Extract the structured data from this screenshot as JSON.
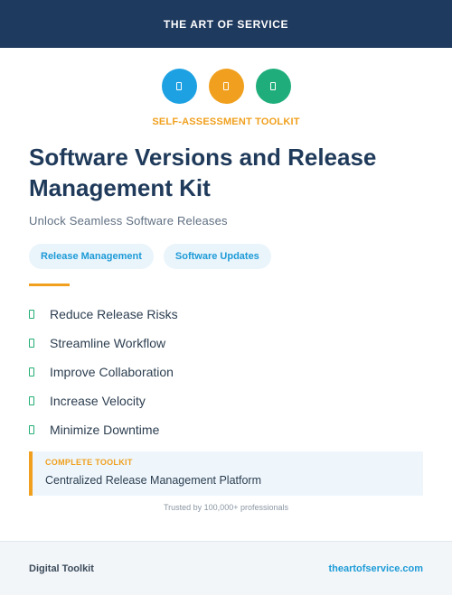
{
  "header": {
    "brand": "THE ART OF SERVICE",
    "color": "#1f3a5f"
  },
  "icons": [
    {
      "name": "document-icon",
      "color": "#1da1e2"
    },
    {
      "name": "document-icon",
      "color": "#f0a01e"
    },
    {
      "name": "document-icon",
      "color": "#1fae7b"
    }
  ],
  "kicker": "SELF-ASSESSMENT TOOLKIT",
  "title": "Software Versions and Release Management Kit",
  "subtitle": "Unlock Seamless Software Releases",
  "tags": [
    "Release Management",
    "Software Updates"
  ],
  "benefits": [
    "Reduce Release Risks",
    "Streamline Workflow",
    "Improve Collaboration",
    "Increase Velocity",
    "Minimize Downtime"
  ],
  "callout": {
    "label": "COMPLETE TOOLKIT",
    "text": "Centralized Release Management Platform"
  },
  "trusted": "Trusted by 100,000+ professionals",
  "footer": {
    "left": "Digital Toolkit",
    "right": "theartofservice.com"
  },
  "colors": {
    "accent": "#f0a01e",
    "link": "#1d9bd7",
    "check": "#22ad73"
  }
}
